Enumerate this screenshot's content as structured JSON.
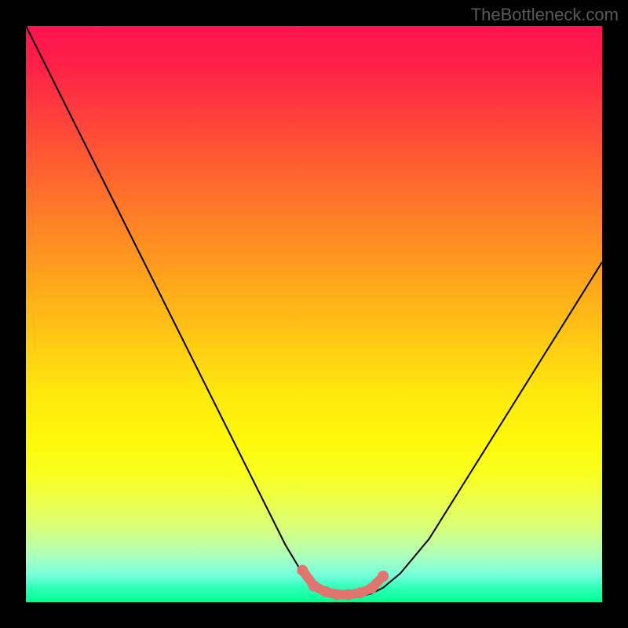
{
  "watermark": "TheBottleneck.com",
  "chart_data": {
    "type": "line",
    "title": "",
    "xlabel": "",
    "ylabel": "",
    "xlim": [
      0,
      100
    ],
    "ylim": [
      0,
      100
    ],
    "grid": false,
    "series": [
      {
        "name": "curve",
        "color": "#000000",
        "x": [
          0,
          5,
          10,
          15,
          20,
          25,
          30,
          35,
          40,
          45,
          48,
          50,
          52,
          55,
          58,
          60,
          62,
          65,
          70,
          75,
          80,
          85,
          90,
          95,
          100
        ],
        "y": [
          100,
          90,
          80,
          70,
          60,
          50,
          40,
          30,
          20,
          10,
          5,
          2.5,
          1.5,
          1,
          1,
          1.5,
          2.5,
          5,
          11,
          19,
          27,
          35,
          43,
          51,
          59
        ]
      }
    ],
    "markers": {
      "name": "optimal-range",
      "color": "#e0746e",
      "x": [
        48,
        50,
        52,
        54,
        56,
        58,
        60,
        62
      ],
      "y": [
        5.5,
        2.8,
        1.8,
        1.3,
        1.3,
        1.6,
        2.4,
        4.5
      ]
    },
    "gradient": {
      "stops": [
        {
          "pos": 0,
          "color": "#ff1450"
        },
        {
          "pos": 50,
          "color": "#ffc814"
        },
        {
          "pos": 80,
          "color": "#f0ff40"
        },
        {
          "pos": 100,
          "color": "#00ff90"
        }
      ]
    }
  }
}
